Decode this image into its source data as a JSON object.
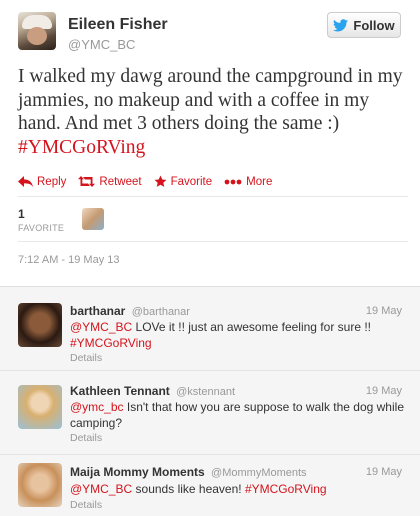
{
  "tweet": {
    "author_name": "Eileen Fisher",
    "author_handle": "@YMC_BC",
    "follow_label": "Follow",
    "text": "I walked my dawg around the campground in my jammies, no makeup and with a coffee in my hand. And met 3 others doing the same :) ",
    "hashtag": "#YMCGoRVing",
    "favorite_count": "1",
    "favorite_label": "FAVORITE",
    "timestamp": "7:12 AM - 19 May 13"
  },
  "actions": {
    "reply": "Reply",
    "retweet": "Retweet",
    "favorite": "Favorite",
    "more": "More"
  },
  "colors": {
    "accent": "#d4141d",
    "twitter_blue": "#2aa3ef"
  },
  "replies": [
    {
      "name": "barthanar",
      "handle": "@barthanar",
      "date": "19 May",
      "mention": "@YMC_BC",
      "text": " LOVe it !!  just an awesome feeling for sure !! ",
      "hashtag": "#YMCGoRVing",
      "details": "Details"
    },
    {
      "name": "Kathleen Tennant",
      "handle": "@kstennant",
      "date": "19 May",
      "mention": "@ymc_bc",
      "text": " Isn't that how you are suppose to walk the dog while camping?",
      "hashtag": "",
      "details": "Details"
    },
    {
      "name": "Maija Mommy Moments",
      "handle": "@MommyMoments",
      "date": "19 May",
      "mention": "@YMC_BC",
      "text": " sounds like heaven! ",
      "hashtag": "#YMCGoRVing",
      "details": "Details"
    }
  ]
}
